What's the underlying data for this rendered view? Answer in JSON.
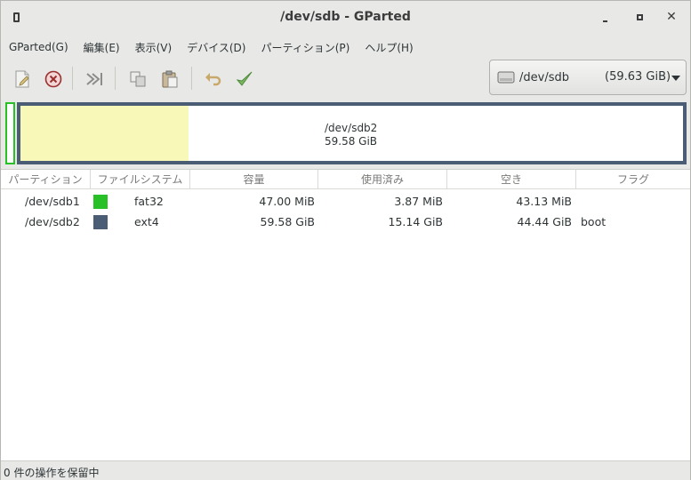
{
  "window": {
    "title": "/dev/sdb - GParted"
  },
  "menu": [
    {
      "label": "GParted(G)"
    },
    {
      "label": "編集(E)"
    },
    {
      "label": "表示(V)"
    },
    {
      "label": "デバイス(D)"
    },
    {
      "label": "パーティション(P)"
    },
    {
      "label": "ヘルプ(H)"
    }
  ],
  "toolbar": {
    "icons": [
      "new-partition-icon",
      "delete-icon",
      "resize-move-icon",
      "copy-icon",
      "paste-icon",
      "undo-icon",
      "apply-icon"
    ],
    "device": {
      "name": "/dev/sdb",
      "size": "(59.63 GiB)"
    }
  },
  "map": {
    "partition1_color": "#27c127",
    "partition2_color": "#4a5d74",
    "partition2_used_fraction": 0.254,
    "partition2_name": "/dev/sdb2",
    "partition2_size": "59.58 GiB"
  },
  "table": {
    "headers": [
      "パーティション",
      "ファイルシステム",
      "容量",
      "使用済み",
      "空き",
      "フラグ"
    ],
    "rows": [
      {
        "partition": "/dev/sdb1",
        "fs_color": "#27c127",
        "filesystem": "fat32",
        "size": "47.00 MiB",
        "used": "3.87 MiB",
        "free": "43.13 MiB",
        "flags": ""
      },
      {
        "partition": "/dev/sdb2",
        "fs_color": "#4a5d74",
        "filesystem": "ext4",
        "size": "59.58 GiB",
        "used": "15.14 GiB",
        "free": "44.44 GiB",
        "flags": "boot"
      }
    ]
  },
  "status": {
    "text": "0 件の操作を保留中"
  }
}
